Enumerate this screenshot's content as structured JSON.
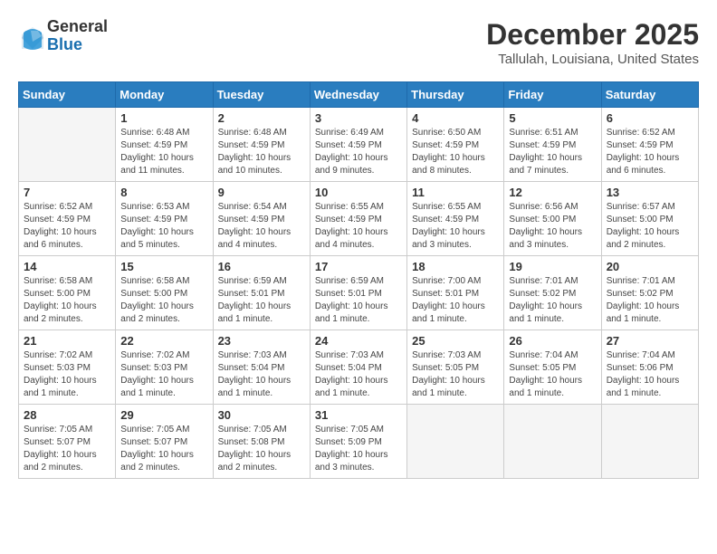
{
  "header": {
    "logo_line1": "General",
    "logo_line2": "Blue",
    "month_year": "December 2025",
    "location": "Tallulah, Louisiana, United States"
  },
  "days_of_week": [
    "Sunday",
    "Monday",
    "Tuesday",
    "Wednesday",
    "Thursday",
    "Friday",
    "Saturday"
  ],
  "weeks": [
    [
      {
        "day": "",
        "info": ""
      },
      {
        "day": "1",
        "info": "Sunrise: 6:48 AM\nSunset: 4:59 PM\nDaylight: 10 hours\nand 11 minutes."
      },
      {
        "day": "2",
        "info": "Sunrise: 6:48 AM\nSunset: 4:59 PM\nDaylight: 10 hours\nand 10 minutes."
      },
      {
        "day": "3",
        "info": "Sunrise: 6:49 AM\nSunset: 4:59 PM\nDaylight: 10 hours\nand 9 minutes."
      },
      {
        "day": "4",
        "info": "Sunrise: 6:50 AM\nSunset: 4:59 PM\nDaylight: 10 hours\nand 8 minutes."
      },
      {
        "day": "5",
        "info": "Sunrise: 6:51 AM\nSunset: 4:59 PM\nDaylight: 10 hours\nand 7 minutes."
      },
      {
        "day": "6",
        "info": "Sunrise: 6:52 AM\nSunset: 4:59 PM\nDaylight: 10 hours\nand 6 minutes."
      }
    ],
    [
      {
        "day": "7",
        "info": "Sunrise: 6:52 AM\nSunset: 4:59 PM\nDaylight: 10 hours\nand 6 minutes."
      },
      {
        "day": "8",
        "info": "Sunrise: 6:53 AM\nSunset: 4:59 PM\nDaylight: 10 hours\nand 5 minutes."
      },
      {
        "day": "9",
        "info": "Sunrise: 6:54 AM\nSunset: 4:59 PM\nDaylight: 10 hours\nand 4 minutes."
      },
      {
        "day": "10",
        "info": "Sunrise: 6:55 AM\nSunset: 4:59 PM\nDaylight: 10 hours\nand 4 minutes."
      },
      {
        "day": "11",
        "info": "Sunrise: 6:55 AM\nSunset: 4:59 PM\nDaylight: 10 hours\nand 3 minutes."
      },
      {
        "day": "12",
        "info": "Sunrise: 6:56 AM\nSunset: 5:00 PM\nDaylight: 10 hours\nand 3 minutes."
      },
      {
        "day": "13",
        "info": "Sunrise: 6:57 AM\nSunset: 5:00 PM\nDaylight: 10 hours\nand 2 minutes."
      }
    ],
    [
      {
        "day": "14",
        "info": "Sunrise: 6:58 AM\nSunset: 5:00 PM\nDaylight: 10 hours\nand 2 minutes."
      },
      {
        "day": "15",
        "info": "Sunrise: 6:58 AM\nSunset: 5:00 PM\nDaylight: 10 hours\nand 2 minutes."
      },
      {
        "day": "16",
        "info": "Sunrise: 6:59 AM\nSunset: 5:01 PM\nDaylight: 10 hours\nand 1 minute."
      },
      {
        "day": "17",
        "info": "Sunrise: 6:59 AM\nSunset: 5:01 PM\nDaylight: 10 hours\nand 1 minute."
      },
      {
        "day": "18",
        "info": "Sunrise: 7:00 AM\nSunset: 5:01 PM\nDaylight: 10 hours\nand 1 minute."
      },
      {
        "day": "19",
        "info": "Sunrise: 7:01 AM\nSunset: 5:02 PM\nDaylight: 10 hours\nand 1 minute."
      },
      {
        "day": "20",
        "info": "Sunrise: 7:01 AM\nSunset: 5:02 PM\nDaylight: 10 hours\nand 1 minute."
      }
    ],
    [
      {
        "day": "21",
        "info": "Sunrise: 7:02 AM\nSunset: 5:03 PM\nDaylight: 10 hours\nand 1 minute."
      },
      {
        "day": "22",
        "info": "Sunrise: 7:02 AM\nSunset: 5:03 PM\nDaylight: 10 hours\nand 1 minute."
      },
      {
        "day": "23",
        "info": "Sunrise: 7:03 AM\nSunset: 5:04 PM\nDaylight: 10 hours\nand 1 minute."
      },
      {
        "day": "24",
        "info": "Sunrise: 7:03 AM\nSunset: 5:04 PM\nDaylight: 10 hours\nand 1 minute."
      },
      {
        "day": "25",
        "info": "Sunrise: 7:03 AM\nSunset: 5:05 PM\nDaylight: 10 hours\nand 1 minute."
      },
      {
        "day": "26",
        "info": "Sunrise: 7:04 AM\nSunset: 5:05 PM\nDaylight: 10 hours\nand 1 minute."
      },
      {
        "day": "27",
        "info": "Sunrise: 7:04 AM\nSunset: 5:06 PM\nDaylight: 10 hours\nand 1 minute."
      }
    ],
    [
      {
        "day": "28",
        "info": "Sunrise: 7:05 AM\nSunset: 5:07 PM\nDaylight: 10 hours\nand 2 minutes."
      },
      {
        "day": "29",
        "info": "Sunrise: 7:05 AM\nSunset: 5:07 PM\nDaylight: 10 hours\nand 2 minutes."
      },
      {
        "day": "30",
        "info": "Sunrise: 7:05 AM\nSunset: 5:08 PM\nDaylight: 10 hours\nand 2 minutes."
      },
      {
        "day": "31",
        "info": "Sunrise: 7:05 AM\nSunset: 5:09 PM\nDaylight: 10 hours\nand 3 minutes."
      },
      {
        "day": "",
        "info": ""
      },
      {
        "day": "",
        "info": ""
      },
      {
        "day": "",
        "info": ""
      }
    ]
  ]
}
